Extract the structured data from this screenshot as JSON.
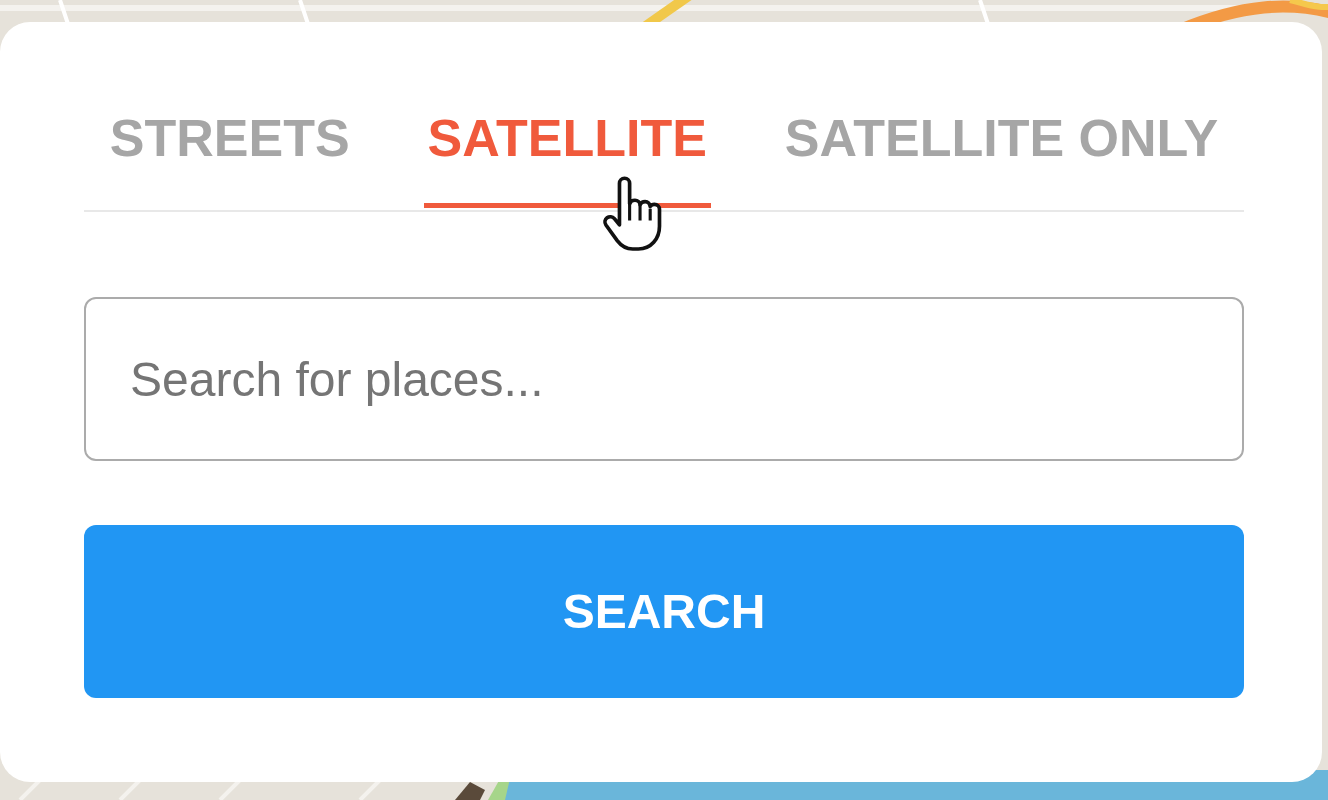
{
  "map_tabs": [
    {
      "label": "STREETS",
      "selected": false
    },
    {
      "label": "SATELLITE",
      "selected": true
    },
    {
      "label": "SATELLITE ONLY",
      "selected": false
    }
  ],
  "search": {
    "placeholder": "Search for places..."
  },
  "search_button": {
    "label": "SEARCH"
  }
}
